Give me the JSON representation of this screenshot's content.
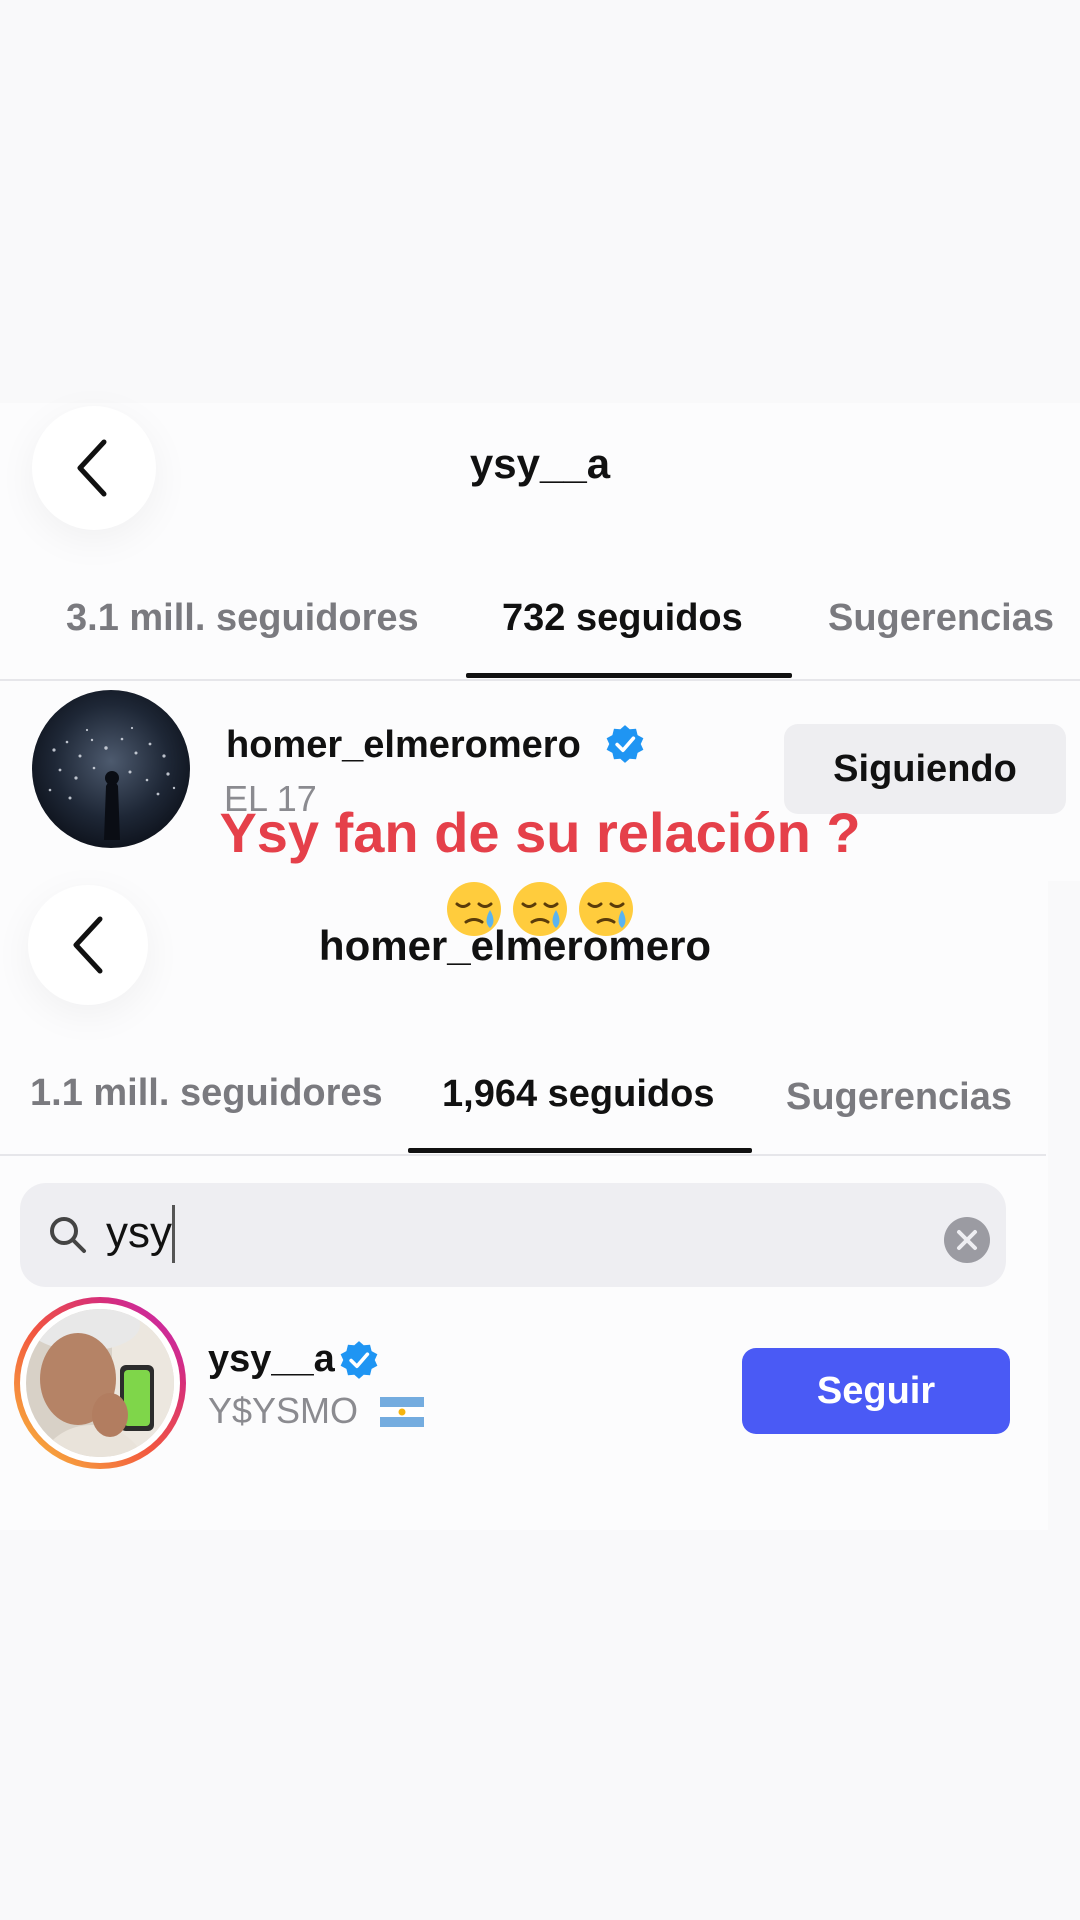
{
  "screen1": {
    "title": "ysy__a",
    "tabs": {
      "followers": "3.1 mill. seguidores",
      "following": "732 seguidos",
      "suggestions": "Sugerencias"
    },
    "user": {
      "username": "homer_elmeromero",
      "subtitle": "EL 17",
      "verified": true,
      "button": "Siguiendo"
    }
  },
  "caption": {
    "text": "Ysy fan de su relación ?",
    "emoji": "sleepy-face x3"
  },
  "screen2": {
    "title": "homer_elmeromero",
    "tabs": {
      "followers": "1.1 mill. seguidores",
      "following": "1,964 seguidos",
      "suggestions": "Sugerencias"
    },
    "search": {
      "value": "ysy"
    },
    "user": {
      "username": "ysy__a",
      "subtitle": "Y$YSMO",
      "flag": "argentina-flag",
      "verified": true,
      "has_story": true,
      "button": "Seguir"
    }
  },
  "colors": {
    "accent_blue": "#4a5af5",
    "verified_blue": "#1f95f3",
    "caption_red": "#e5404a"
  }
}
